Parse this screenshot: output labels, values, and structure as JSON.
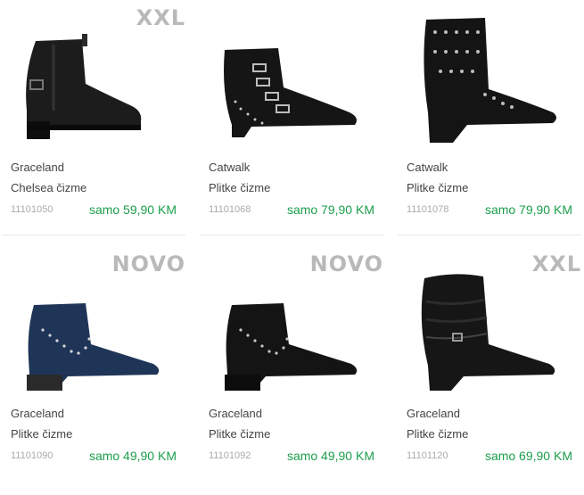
{
  "products": [
    {
      "badge": "XXL",
      "brand": "Graceland",
      "category": "Chelsea čizme",
      "sku": "11101050",
      "price": "samo 59,90 KM",
      "color": "#1c1c1c",
      "icon": "chelsea-boot-icon"
    },
    {
      "badge": "",
      "brand": "Catwalk",
      "category": "Plitke čizme",
      "sku": "11101068",
      "price": "samo 79,90 KM",
      "color": "#151515",
      "icon": "buckle-boot-icon"
    },
    {
      "badge": "",
      "brand": "Catwalk",
      "category": "Plitke čizme",
      "sku": "11101078",
      "price": "samo 79,90 KM",
      "color": "#141414",
      "icon": "studded-boot-icon"
    },
    {
      "badge": "NOVO",
      "brand": "Graceland",
      "category": "Plitke čizme",
      "sku": "11101090",
      "price": "samo 49,90 KM",
      "color": "#1f3558",
      "icon": "studded-ankle-boot-icon"
    },
    {
      "badge": "NOVO",
      "brand": "Graceland",
      "category": "Plitke čizme",
      "sku": "11101092",
      "price": "samo 49,90 KM",
      "color": "#141414",
      "icon": "studded-ankle-boot-icon"
    },
    {
      "badge": "XXL",
      "brand": "Graceland",
      "category": "Plitke čizme",
      "sku": "11101120",
      "price": "samo 69,90 KM",
      "color": "#161616",
      "icon": "slouch-boot-icon"
    }
  ]
}
